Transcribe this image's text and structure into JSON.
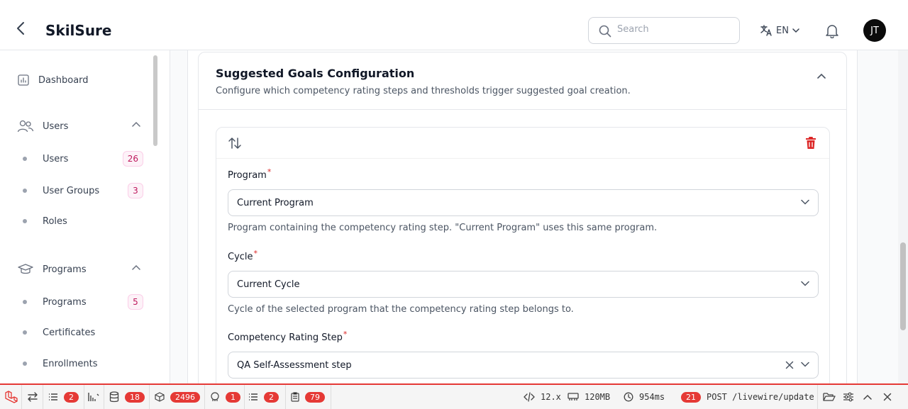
{
  "header": {
    "app_title": "SkilSure",
    "search_placeholder": "Search",
    "language": "EN",
    "avatar_initials": "JT"
  },
  "sidebar": {
    "dashboard": "Dashboard",
    "users_group": "Users",
    "users": "Users",
    "users_count": "26",
    "user_groups": "User Groups",
    "user_groups_count": "3",
    "roles": "Roles",
    "programs_group": "Programs",
    "programs": "Programs",
    "programs_count": "5",
    "certificates": "Certificates",
    "enrollments": "Enrollments"
  },
  "section": {
    "title": "Suggested Goals Configuration",
    "description": "Configure which competency rating steps and thresholds trigger suggested goal creation."
  },
  "form": {
    "program_label": "Program",
    "program_value": "Current Program",
    "program_help": "Program containing the competency rating step. \"Current Program\" uses this same program.",
    "cycle_label": "Cycle",
    "cycle_value": "Current Cycle",
    "cycle_help": "Cycle of the selected program that the competency rating step belongs to.",
    "step_label": "Competency Rating Step",
    "step_value": "QA Self-Assessment step",
    "required_mark": "*"
  },
  "debugbar": {
    "requests": "2",
    "queries": "18",
    "models": "2496",
    "views": "1",
    "events": "2",
    "logs": "79",
    "version": "12.x",
    "memory": "120MB",
    "duration": "954ms",
    "request_count": "21",
    "request": "POST /livewire/update"
  },
  "colors": {
    "accent_red": "#e53935",
    "badge_pink": "#be185d",
    "danger": "#dc2626"
  }
}
